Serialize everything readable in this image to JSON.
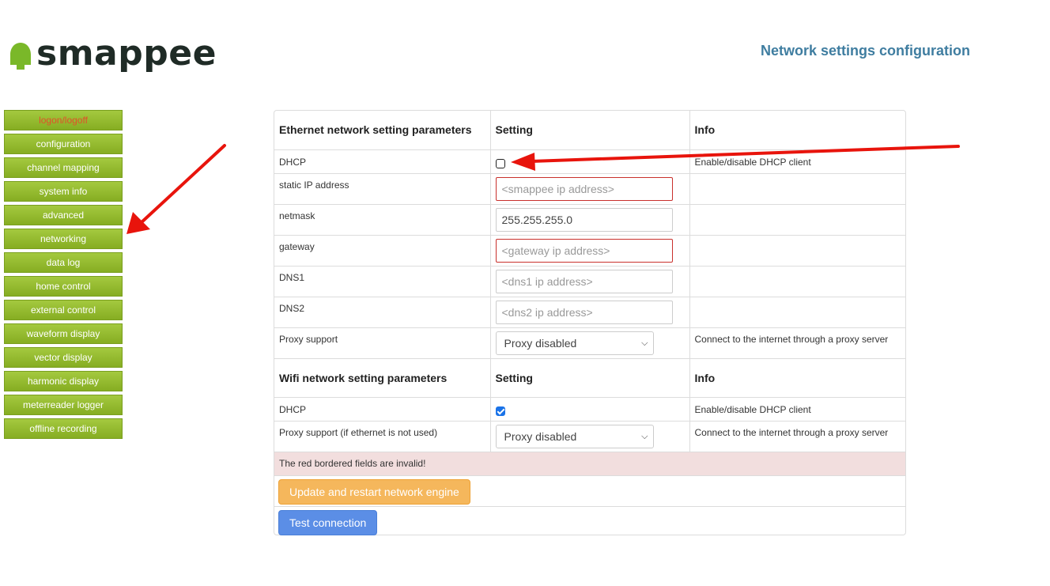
{
  "brand": {
    "logo_text": "smappee",
    "logo_color": "#7ab829"
  },
  "page_title": "Network settings configuration",
  "sidebar": {
    "items": [
      {
        "label": "logon/logoff"
      },
      {
        "label": "configuration"
      },
      {
        "label": "channel mapping"
      },
      {
        "label": "system info"
      },
      {
        "label": "advanced"
      },
      {
        "label": "networking"
      },
      {
        "label": "data log"
      },
      {
        "label": "home control"
      },
      {
        "label": "external control"
      },
      {
        "label": "waveform display"
      },
      {
        "label": "vector display"
      },
      {
        "label": "harmonic display"
      },
      {
        "label": "meterreader logger"
      },
      {
        "label": "offline recording"
      }
    ]
  },
  "ethernet": {
    "header": {
      "param": "Ethernet network setting parameters",
      "setting": "Setting",
      "info": "Info"
    },
    "dhcp": {
      "label": "DHCP",
      "checked": false,
      "info": "Enable/disable DHCP client"
    },
    "static_ip": {
      "label": "static IP address",
      "value": "",
      "placeholder": "<smappee ip address>"
    },
    "netmask": {
      "label": "netmask",
      "value": "255.255.255.0",
      "placeholder": ""
    },
    "gateway": {
      "label": "gateway",
      "value": "",
      "placeholder": "<gateway ip address>"
    },
    "dns1": {
      "label": "DNS1",
      "value": "",
      "placeholder": "<dns1 ip address>"
    },
    "dns2": {
      "label": "DNS2",
      "value": "",
      "placeholder": "<dns2 ip address>"
    },
    "proxy": {
      "label": "Proxy support",
      "selected": "Proxy disabled",
      "info": "Connect to the internet through a proxy server"
    }
  },
  "wifi": {
    "header": {
      "param": "Wifi network setting parameters",
      "setting": "Setting",
      "info": "Info"
    },
    "dhcp": {
      "label": "DHCP",
      "checked": true,
      "info": "Enable/disable DHCP client"
    },
    "proxy": {
      "label": "Proxy support (if ethernet is not used)",
      "selected": "Proxy disabled",
      "info": "Connect to the internet through a proxy server"
    }
  },
  "error_message": "The red bordered fields are invalid!",
  "buttons": {
    "update": "Update and restart network engine",
    "test": "Test connection"
  }
}
